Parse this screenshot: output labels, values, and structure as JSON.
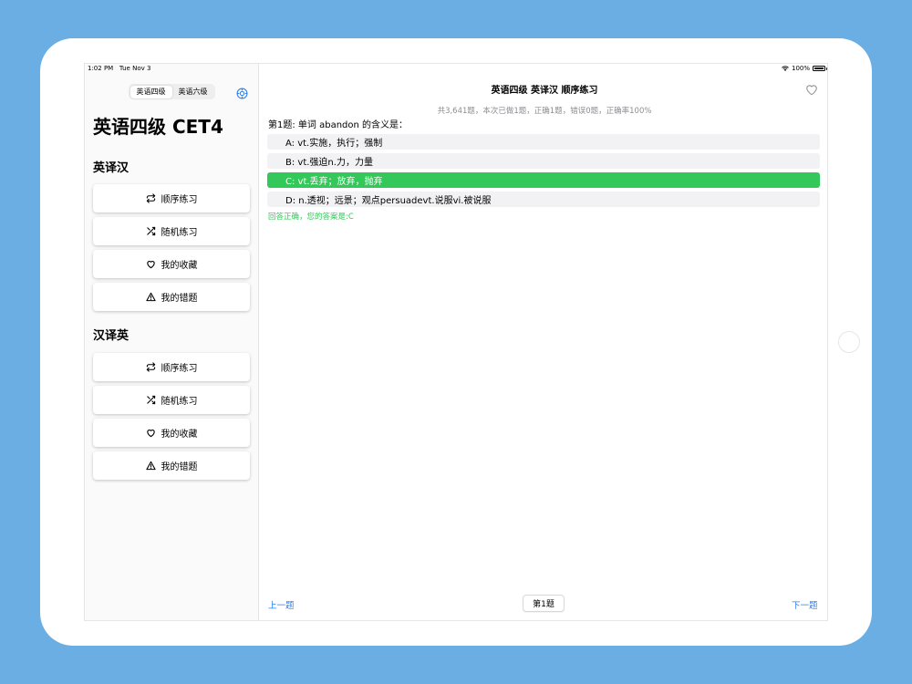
{
  "status_bar": {
    "time": "1:02 PM",
    "date": "Tue Nov 3",
    "battery": "100%",
    "battery_level": 1.0
  },
  "sidebar": {
    "segments": [
      {
        "label": "英语四级",
        "selected": true
      },
      {
        "label": "英语六级",
        "selected": false
      }
    ],
    "settings_icon": "gear-icon",
    "title": "英语四级 CET4",
    "sections": [
      {
        "title": "英译汉",
        "buttons": [
          {
            "label": "顺序练习",
            "icon": "repeat-icon"
          },
          {
            "label": "随机练习",
            "icon": "shuffle-icon"
          },
          {
            "label": "我的收藏",
            "icon": "heart-icon"
          },
          {
            "label": "我的错题",
            "icon": "warning-icon"
          }
        ]
      },
      {
        "title": "汉译英",
        "buttons": [
          {
            "label": "顺序练习",
            "icon": "repeat-icon"
          },
          {
            "label": "随机练习",
            "icon": "shuffle-icon"
          },
          {
            "label": "我的收藏",
            "icon": "heart-icon"
          },
          {
            "label": "我的错题",
            "icon": "warning-icon"
          }
        ]
      }
    ]
  },
  "main": {
    "nav_title": "英语四级 英译汉 顺序练习",
    "favorite_icon": "heart-outline-icon",
    "stats": "共3,641题，本次已做1题，正确1题，错误0题，正确率100%",
    "question": "第1题: 单词 abandon 的含义是：",
    "options": [
      {
        "text": "A: vt.实施，执行；强制",
        "state": "normal"
      },
      {
        "text": "B: vt.强迫n.力，力量",
        "state": "normal"
      },
      {
        "text": "C: vt.丢弃；放弃，抛弃",
        "state": "correct"
      },
      {
        "text": "D: n.透视；远景；观点persuadevt.说服vi.被说服",
        "state": "normal"
      }
    ],
    "feedback": "回答正确，您的答案是:C",
    "prev_label": "上一题",
    "page_label": "第1题",
    "next_label": "下一题"
  },
  "colors": {
    "accent": "#2f80ed",
    "correct": "#34c759",
    "background": "#6aaee3"
  }
}
